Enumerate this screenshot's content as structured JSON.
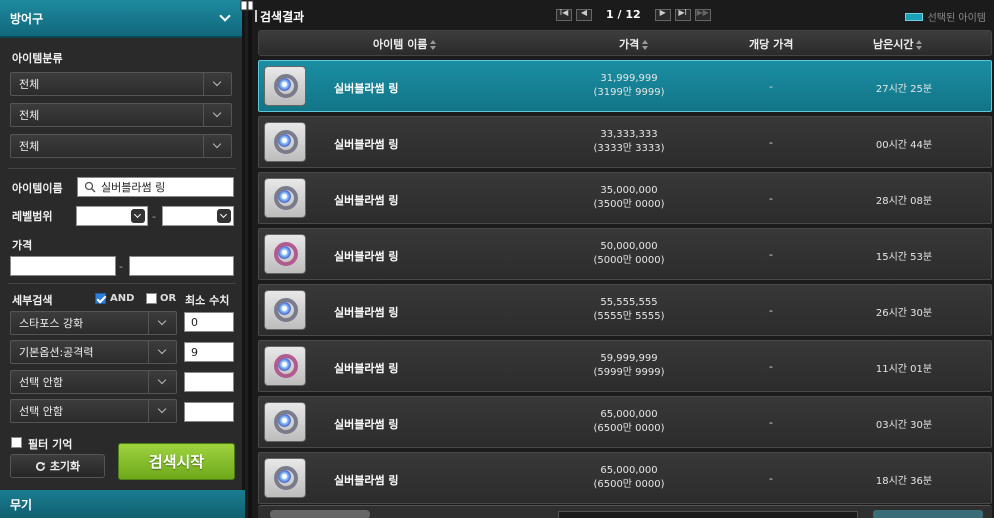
{
  "sidebar": {
    "category_title": "방어구",
    "item_class_label": "아이템분류",
    "class_selects": [
      "전체",
      "전체",
      "전체"
    ],
    "item_name_label": "아이템이름",
    "item_name_value": "실버블라썸 링",
    "level_range_label": "레벨범위",
    "range_dash": "-",
    "price_label": "가격",
    "detail_label": "세부검색",
    "and_label": "AND",
    "or_label": "OR",
    "min_value_label": "최소 수치",
    "details": [
      {
        "option": "스타포스 강화",
        "value": "0"
      },
      {
        "option": "기본옵션:공격력",
        "value": "9"
      },
      {
        "option": "선택 안함",
        "value": ""
      },
      {
        "option": "선택 안함",
        "value": ""
      }
    ],
    "remember_filter_label": "필터 기억",
    "reset_label": "초기화",
    "search_label": "검색시작",
    "weapon_title": "무기"
  },
  "main": {
    "title": "검색결과",
    "pager": {
      "first": "I◀",
      "prev": "◀",
      "text": "1 / 12",
      "next": "▶",
      "last": "▶I",
      "end": "▶▶"
    },
    "legend_label": "선택된 아이템",
    "columns": {
      "name": "아이템 이름",
      "price": "가격",
      "unit_price": "개당 가격",
      "time_left": "남은시간"
    }
  },
  "rows": [
    {
      "name": "실버블라썸 링",
      "price": "31,999,999",
      "price_man": "(3199만 9999)",
      "unit": "-",
      "time": "27시간 25분",
      "selected": true
    },
    {
      "name": "실버블라썸 링",
      "price": "33,333,333",
      "price_man": "(3333만 3333)",
      "unit": "-",
      "time": "00시간 44분",
      "selected": false
    },
    {
      "name": "실버블라썸 링",
      "price": "35,000,000",
      "price_man": "(3500만 0000)",
      "unit": "-",
      "time": "28시간 08분",
      "selected": false
    },
    {
      "name": "실버블라썸 링",
      "price": "50,000,000",
      "price_man": "(5000만 0000)",
      "unit": "-",
      "time": "15시간 53분",
      "selected": false
    },
    {
      "name": "실버블라썸 링",
      "price": "55,555,555",
      "price_man": "(5555만 5555)",
      "unit": "-",
      "time": "26시간 30분",
      "selected": false
    },
    {
      "name": "실버블라썸 링",
      "price": "59,999,999",
      "price_man": "(5999만 9999)",
      "unit": "-",
      "time": "11시간 01분",
      "selected": false
    },
    {
      "name": "실버블라썸 링",
      "price": "65,000,000",
      "price_man": "(6500만 0000)",
      "unit": "-",
      "time": "03시간 30분",
      "selected": false
    },
    {
      "name": "실버블라썸 링",
      "price": "65,000,000",
      "price_man": "(6500만 0000)",
      "unit": "-",
      "time": "18시간 36분",
      "selected": false
    }
  ],
  "colors": {
    "accent": "#1a8ea3",
    "search_button": "#8cc332"
  },
  "icons": [
    "chevron-down-icon",
    "search-icon",
    "refresh-icon",
    "ring-icon"
  ]
}
